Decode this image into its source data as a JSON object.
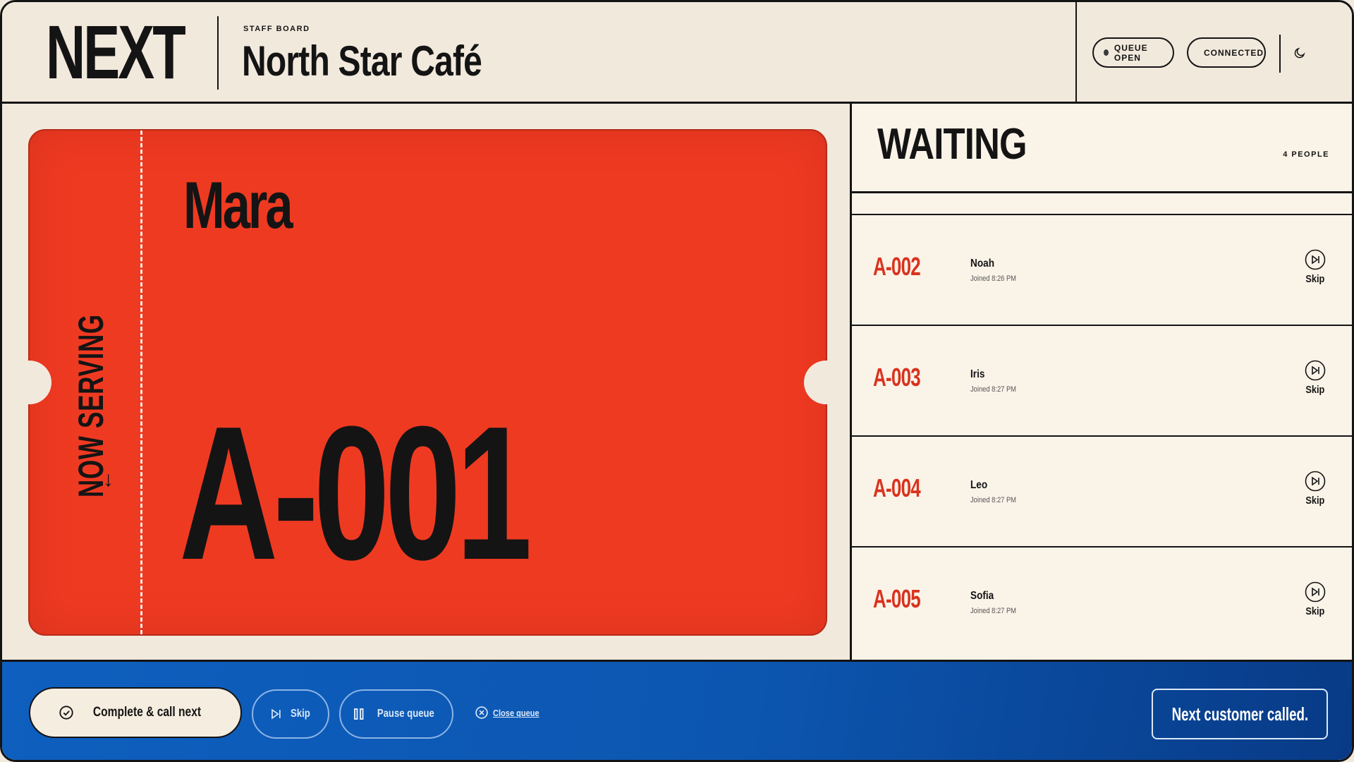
{
  "header": {
    "brand": "NEXT",
    "board_label": "STAFF BOARD",
    "venue": "North Star Café",
    "status_queue": "QUEUE OPEN",
    "status_connection": "CONNECTED",
    "theme_icon": "moon-icon"
  },
  "now_serving": {
    "label": "NOW SERVING",
    "arrow": "↓",
    "name": "Mara",
    "number": "A-001",
    "accent": "#ef3a22"
  },
  "waiting": {
    "title": "WAITING",
    "count": "4 PEOPLE",
    "rows": [
      {
        "number": "A-002",
        "name": "Noah",
        "time": "Joined 8:26 PM",
        "skip": "Skip"
      },
      {
        "number": "A-003",
        "name": "Iris",
        "time": "Joined 8:27 PM",
        "skip": "Skip"
      },
      {
        "number": "A-004",
        "name": "Leo",
        "time": "Joined 8:27 PM",
        "skip": "Skip"
      },
      {
        "number": "A-005",
        "name": "Sofia",
        "time": "Joined 8:27 PM",
        "skip": "Skip"
      }
    ]
  },
  "footer": {
    "complete_label": "Complete & call next",
    "skip_label": "Skip",
    "pause_label": "Pause queue",
    "close_label": "Close queue",
    "toast": "Next customer called.",
    "bar_color": "#0c56b0"
  }
}
